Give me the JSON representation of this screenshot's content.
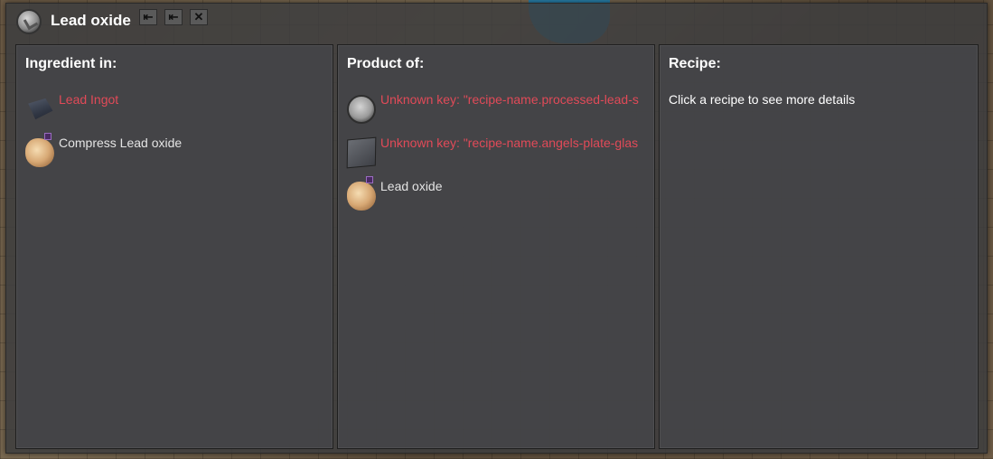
{
  "window": {
    "title": "Lead oxide",
    "buttons": [
      "⇤",
      "⇤",
      "✕"
    ]
  },
  "panels": {
    "ingredient_in": {
      "title": "Ingredient in:",
      "items": [
        {
          "label": "Lead Ingot",
          "icon": "lead-ingot-icon",
          "color": "#e14a58"
        },
        {
          "label": "Compress Lead oxide",
          "icon": "lead-oxide-icon",
          "color": "#e4e4e4"
        }
      ]
    },
    "product_of": {
      "title": "Product of:",
      "items": [
        {
          "label": "Unknown key: \"recipe-name.processed-lead-s",
          "icon": "processed-lead-icon",
          "color": "#e14a58"
        },
        {
          "label": "Unknown key: \"recipe-name.angels-plate-glas",
          "icon": "plate-glass-icon",
          "color": "#e14a58"
        },
        {
          "label": "Lead oxide",
          "icon": "lead-oxide-icon",
          "color": "#e4e4e4"
        }
      ]
    },
    "recipe": {
      "title": "Recipe:",
      "hint": "Click a recipe to see more details"
    }
  }
}
